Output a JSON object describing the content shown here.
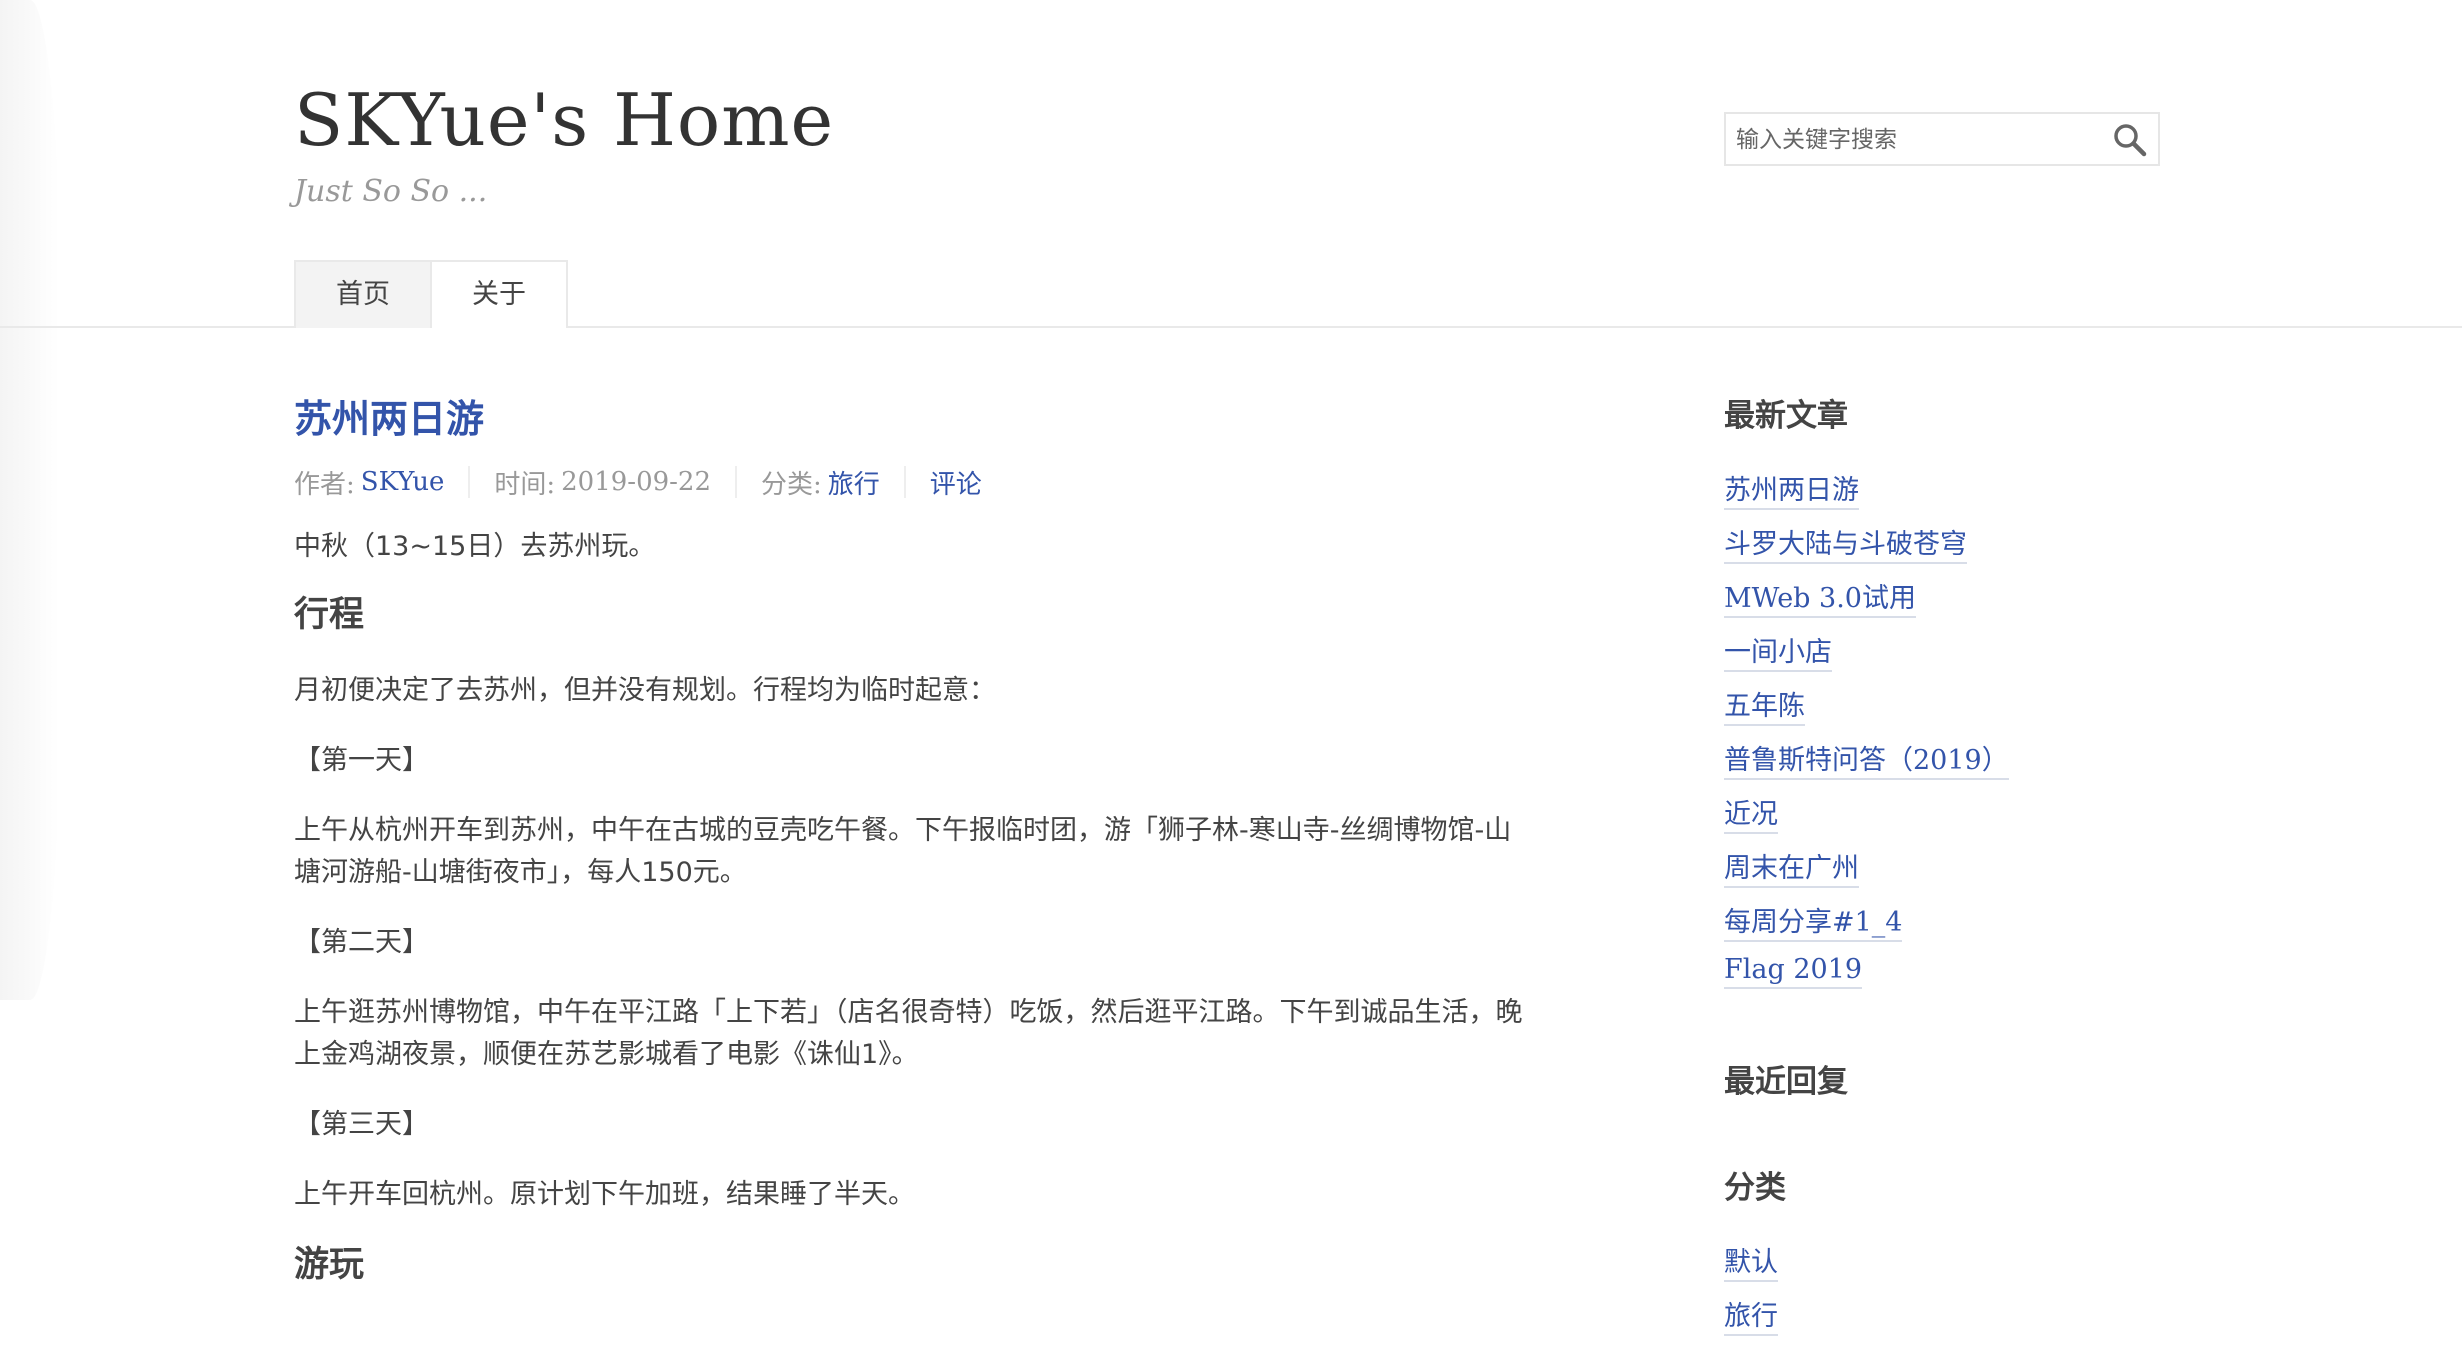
{
  "site": {
    "title": "SKYue's Home",
    "description": "Just So So ..."
  },
  "search": {
    "placeholder": "输入关键字搜索",
    "icon": "search-icon"
  },
  "nav": [
    {
      "label": "首页",
      "active": true
    },
    {
      "label": "关于",
      "active": false
    }
  ],
  "post": {
    "title": "苏州两日游",
    "meta": {
      "author_label": "作者:",
      "author": "SKYue",
      "date_label": "时间:",
      "date": "2019-09-22",
      "category_label": "分类:",
      "category": "旅行",
      "comments": "评论"
    },
    "body": [
      {
        "type": "p",
        "text": "中秋（13~15日）去苏州玩。"
      },
      {
        "type": "h2",
        "text": "行程"
      },
      {
        "type": "p",
        "text": "月初便决定了去苏州，但并没有规划。行程均为临时起意："
      },
      {
        "type": "p",
        "text": "【第一天】"
      },
      {
        "type": "p",
        "text": "上午从杭州开车到苏州，中午在古城的豆壳吃午餐。下午报临时团，游「狮子林-寒山寺-丝绸博物馆-山塘河游船-山塘街夜市」，每人150元。"
      },
      {
        "type": "p",
        "text": "【第二天】"
      },
      {
        "type": "p",
        "text": "上午逛苏州博物馆，中午在平江路「上下若」（店名很奇特）吃饭，然后逛平江路。下午到诚品生活，晚上金鸡湖夜景，顺便在苏艺影城看了电影《诛仙1》。"
      },
      {
        "type": "p",
        "text": "【第三天】"
      },
      {
        "type": "p",
        "text": "上午开车回杭州。原计划下午加班，结果睡了半天。"
      },
      {
        "type": "h2",
        "text": "游玩"
      }
    ]
  },
  "sidebar": {
    "recent_posts": {
      "title": "最新文章",
      "items": [
        "苏州两日游",
        "斗罗大陆与斗破苍穹",
        "MWeb 3.0试用",
        "一间小店",
        "五年陈",
        "普鲁斯特问答（2019）",
        "近况",
        "周末在广州",
        "每周分享#1_4",
        "Flag 2019"
      ]
    },
    "recent_comments": {
      "title": "最近回复"
    },
    "categories": {
      "title": "分类",
      "items": [
        "默认",
        "旅行"
      ]
    }
  },
  "colors": {
    "link": "#3354aa",
    "text": "#444444",
    "muted": "#999999",
    "border": "#e9e9e9"
  }
}
